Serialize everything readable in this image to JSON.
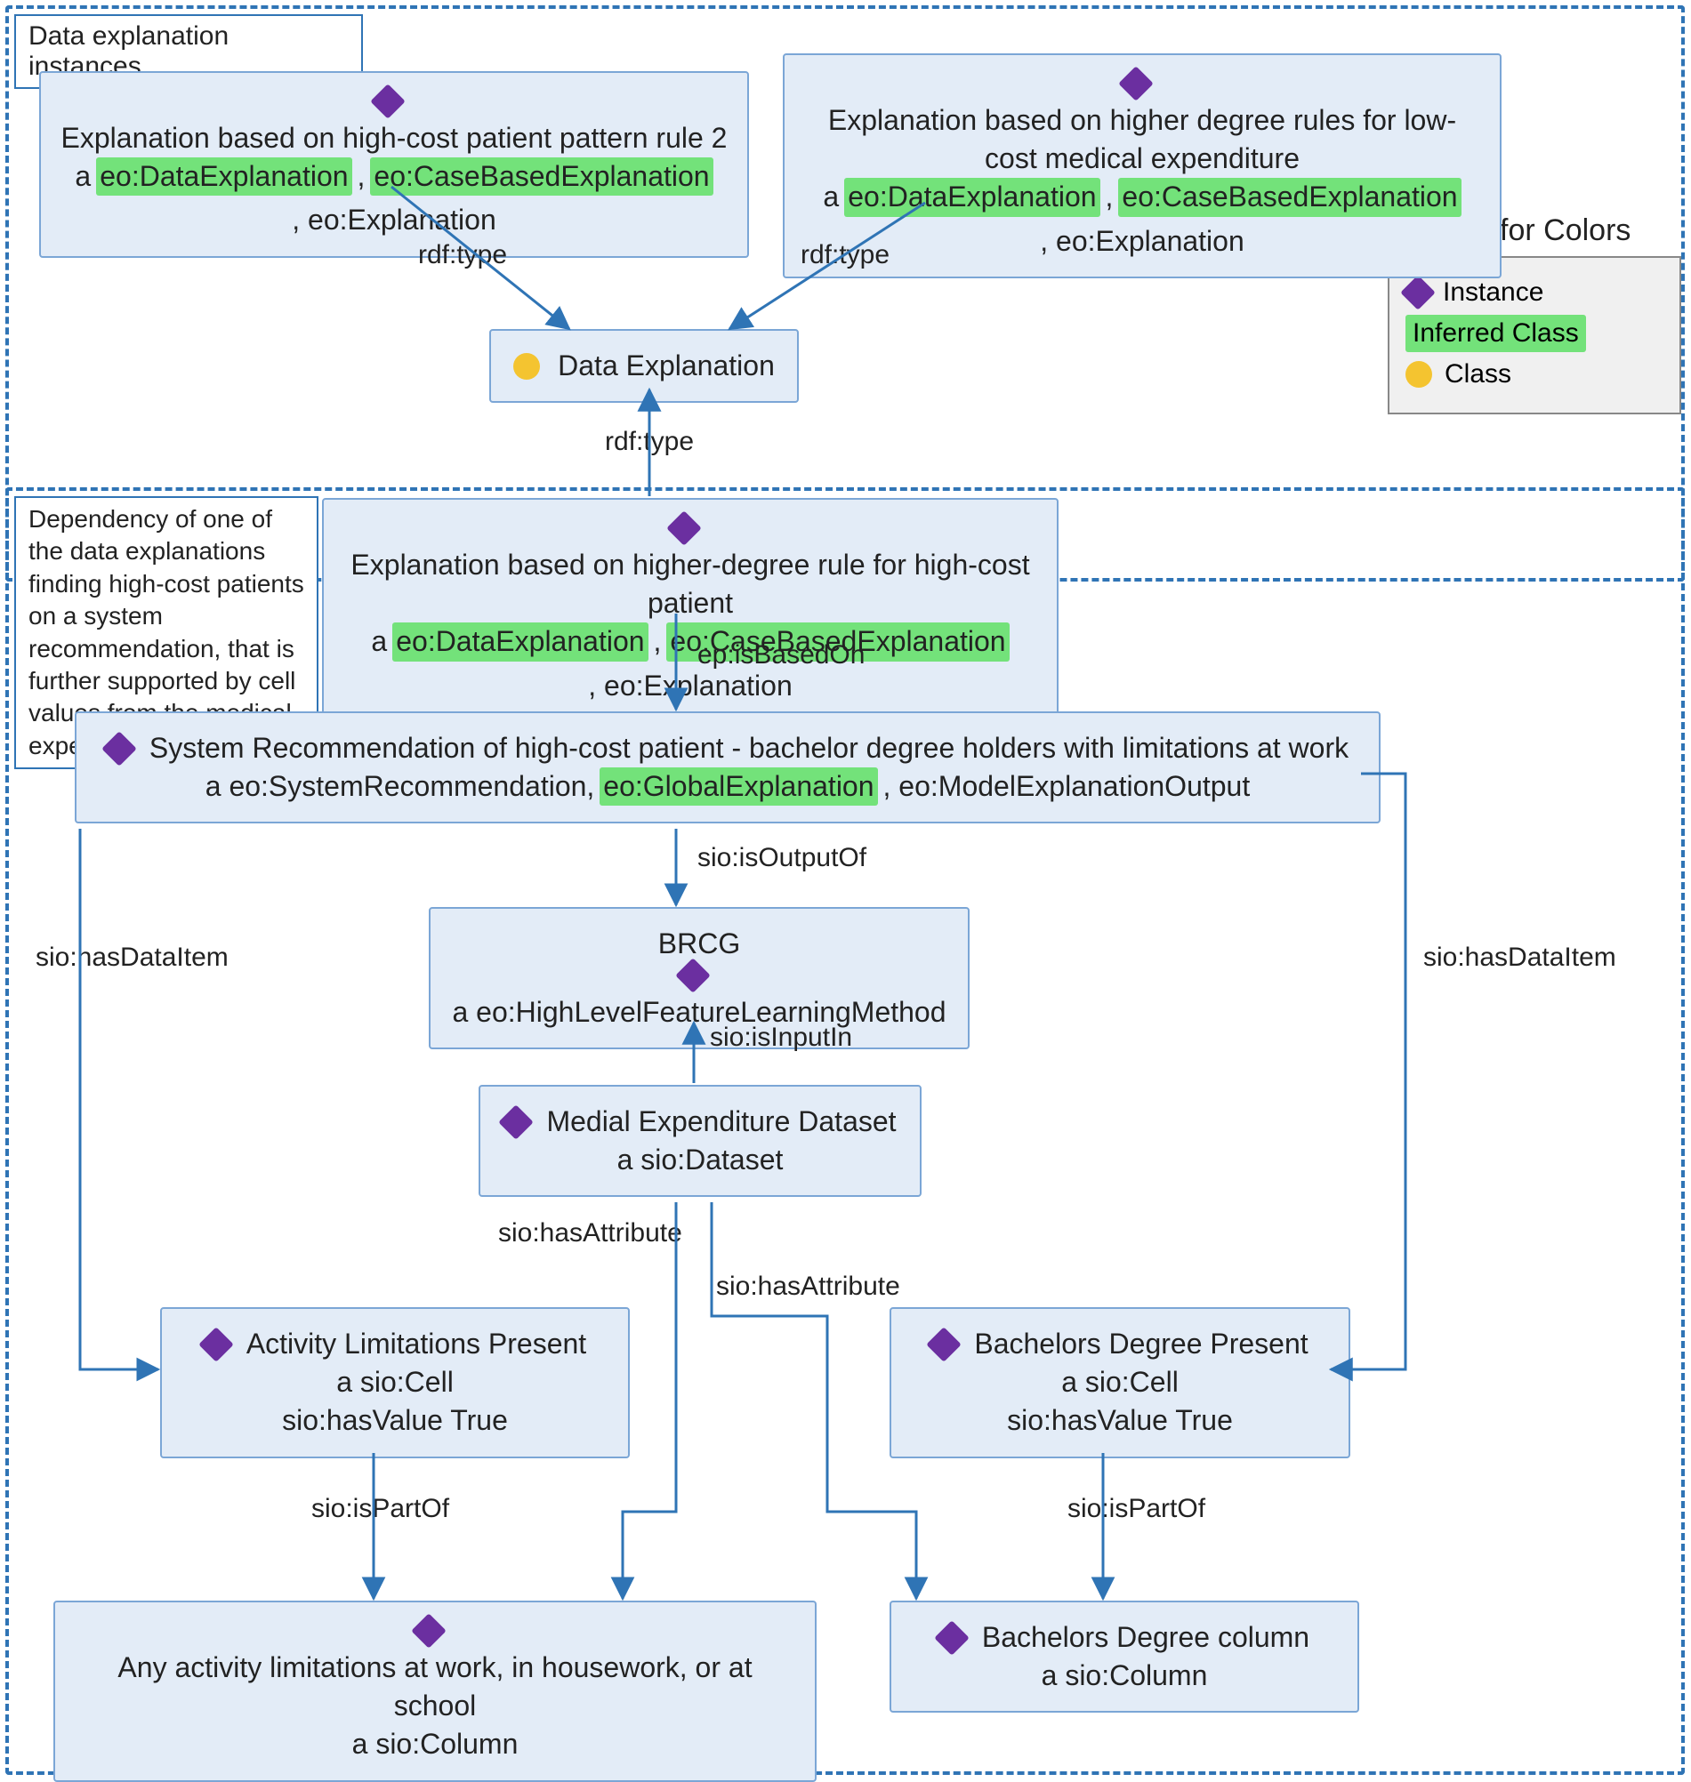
{
  "sections": {
    "top_label": "Data explanation instances.",
    "dep_label": "Dependency of one of the data explanations finding high-cost patients on a system recommendation, that is further supported by cell values from the medical expenditure dataset."
  },
  "legend": {
    "title": "Key for Colors",
    "instance": "Instance",
    "inferred": "Inferred Class",
    "class": "Class"
  },
  "nodes": {
    "exp_rule2": {
      "title": "Explanation based on high-cost patient pattern rule 2",
      "prefix": "a ",
      "hl1": "eo:DataExplanation",
      "sep1": ", ",
      "hl2": "eo:CaseBasedExplanation",
      "tail": ", eo:Explanation"
    },
    "exp_lowcost": {
      "title": "Explanation based on higher degree rules for low-cost medical expenditure",
      "prefix": "a ",
      "hl1": "eo:DataExplanation",
      "sep1": ", ",
      "hl2": "eo:CaseBasedExplanation",
      "tail": ", eo:Explanation"
    },
    "data_exp": "Data Explanation",
    "exp_highcost": {
      "title": "Explanation based on higher-degree rule for high-cost patient",
      "prefix": "a ",
      "hl1": "eo:DataExplanation",
      "sep1": ", ",
      "hl2": "eo:CaseBasedExplanation",
      "tail": ", eo:Explanation"
    },
    "sysrec": {
      "title": "System Recommendation of high-cost patient - bachelor degree holders with limitations at work",
      "prefix": "a eo:SystemRecommendation, ",
      "hl1": "eo:GlobalExplanation",
      "tail": ", eo:ModelExplanationOutput"
    },
    "brcg": {
      "line1": "BRCG",
      "line2": "a eo:HighLevelFeatureLearningMethod"
    },
    "dataset": {
      "line1": "Medial Expenditure Dataset",
      "line2": "a sio:Dataset"
    },
    "activity_cell": {
      "line1": "Activity Limitations Present",
      "line2": "a sio:Cell",
      "line3": "sio:hasValue True"
    },
    "bachelors_cell": {
      "line1": "Bachelors Degree Present",
      "line2": "a sio:Cell",
      "line3": "sio:hasValue True"
    },
    "activity_col": {
      "line1": "Any activity limitations at work, in housework, or at school",
      "line2": "a sio:Column"
    },
    "bachelors_col": {
      "line1": "Bachelors Degree column",
      "line2": "a sio:Column"
    }
  },
  "edges": {
    "rdf_type": "rdf:type",
    "ep_isBasedOn": "ep:isBasedOn",
    "sio_isOutputOf": "sio:isOutputOf",
    "sio_isInputIn": "sio:isInputIn",
    "sio_hasAttribute": "sio:hasAttribute",
    "sio_hasDataItem": "sio:hasDataItem",
    "sio_isPartOf": "sio:isPartOf"
  }
}
